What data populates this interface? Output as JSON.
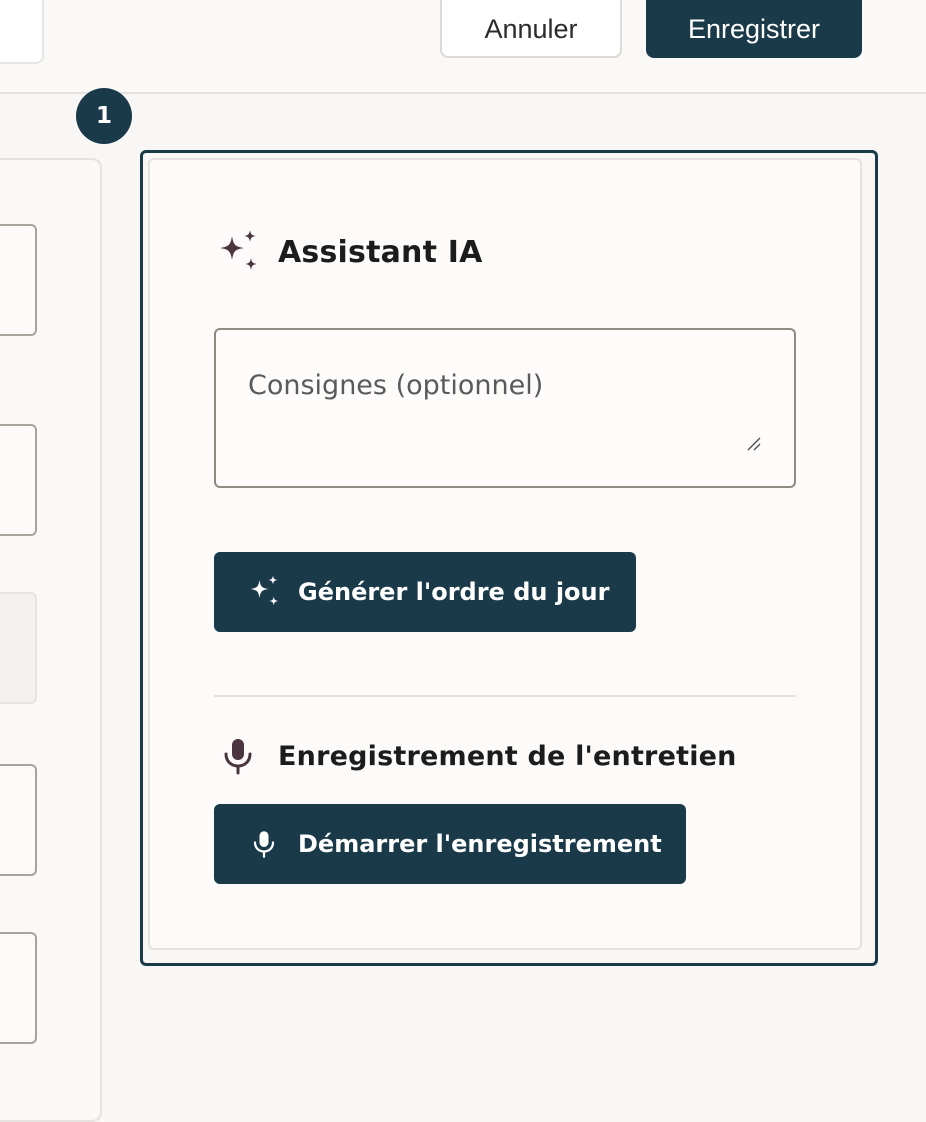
{
  "header": {
    "cancel_label": "Annuler",
    "save_label": "Enregistrer"
  },
  "step": {
    "number": "1"
  },
  "ai_assistant": {
    "title": "Assistant IA",
    "icon": "sparkles-icon",
    "instructions_placeholder": "Consignes (optionnel)",
    "instructions_value": "",
    "generate_label": "Générer l'ordre du jour"
  },
  "recording": {
    "title": "Enregistrement de l'entretien",
    "icon": "microphone-icon",
    "start_label": "Démarrer l'enregistrement"
  },
  "colors": {
    "primary": "#1a3a4a",
    "accent_icon": "#4a3440",
    "card_border": "#1a3a4a"
  }
}
